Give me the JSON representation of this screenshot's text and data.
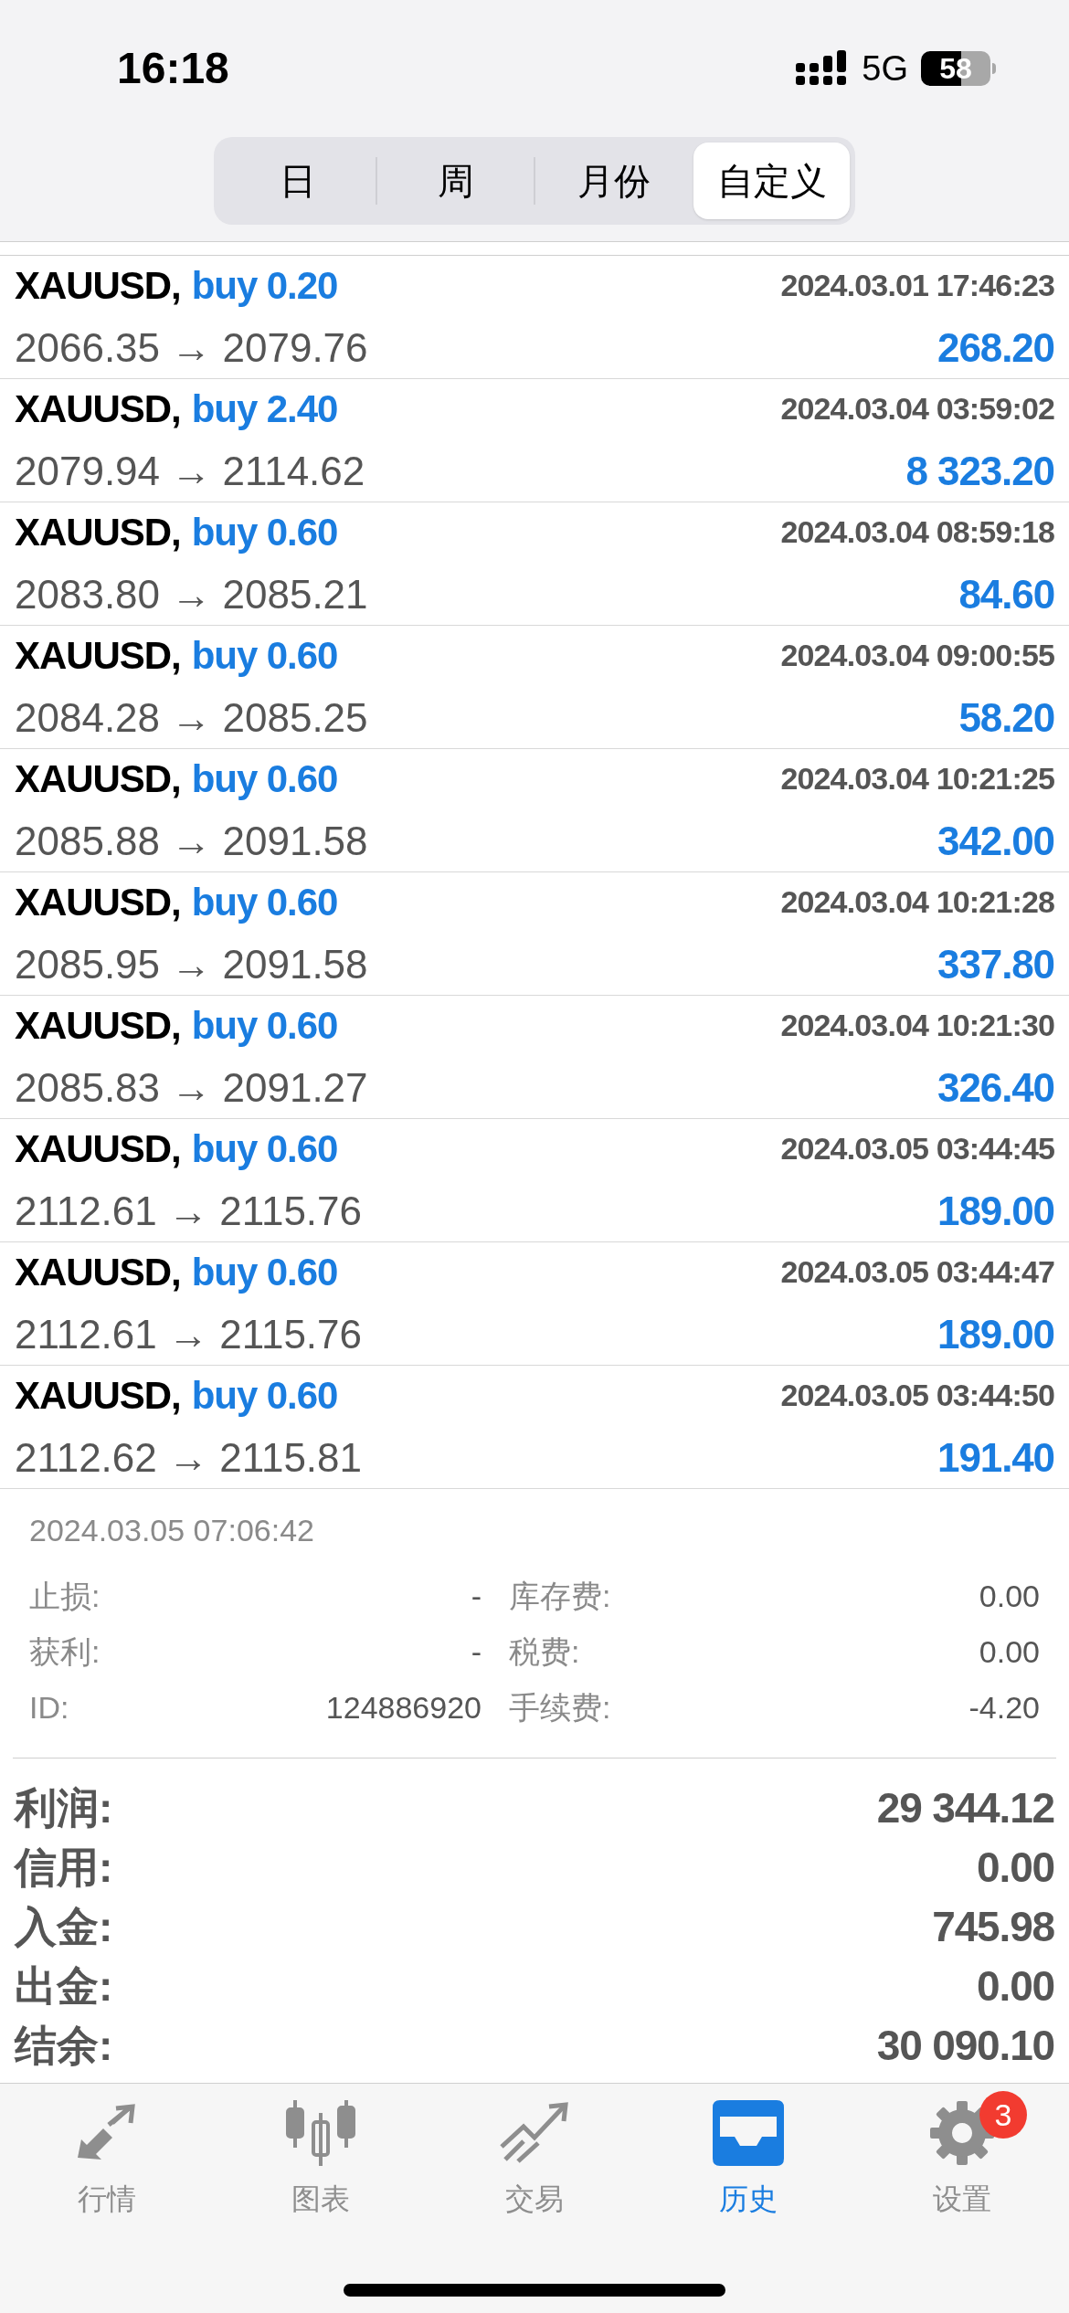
{
  "status_bar": {
    "time": "16:18",
    "network": "5G",
    "battery": "58"
  },
  "period_tabs": [
    {
      "label": "日",
      "selected": false
    },
    {
      "label": "周",
      "selected": false
    },
    {
      "label": "月份",
      "selected": false
    },
    {
      "label": "自定义",
      "selected": true
    }
  ],
  "deals": [
    {
      "symbol": "XAUUSD,",
      "side": "buy 0.20",
      "time": "2024.03.01 17:46:23",
      "prices": "2066.35 → 2079.76",
      "profit": "268.20"
    },
    {
      "symbol": "XAUUSD,",
      "side": "buy 2.40",
      "time": "2024.03.04 03:59:02",
      "prices": "2079.94 → 2114.62",
      "profit": "8 323.20"
    },
    {
      "symbol": "XAUUSD,",
      "side": "buy 0.60",
      "time": "2024.03.04 08:59:18",
      "prices": "2083.80 → 2085.21",
      "profit": "84.60"
    },
    {
      "symbol": "XAUUSD,",
      "side": "buy 0.60",
      "time": "2024.03.04 09:00:55",
      "prices": "2084.28 → 2085.25",
      "profit": "58.20"
    },
    {
      "symbol": "XAUUSD,",
      "side": "buy 0.60",
      "time": "2024.03.04 10:21:25",
      "prices": "2085.88 → 2091.58",
      "profit": "342.00"
    },
    {
      "symbol": "XAUUSD,",
      "side": "buy 0.60",
      "time": "2024.03.04 10:21:28",
      "prices": "2085.95 → 2091.58",
      "profit": "337.80"
    },
    {
      "symbol": "XAUUSD,",
      "side": "buy 0.60",
      "time": "2024.03.04 10:21:30",
      "prices": "2085.83 → 2091.27",
      "profit": "326.40"
    },
    {
      "symbol": "XAUUSD,",
      "side": "buy 0.60",
      "time": "2024.03.05 03:44:45",
      "prices": "2112.61 → 2115.76",
      "profit": "189.00"
    },
    {
      "symbol": "XAUUSD,",
      "side": "buy 0.60",
      "time": "2024.03.05 03:44:47",
      "prices": "2112.61 → 2115.76",
      "profit": "189.00"
    },
    {
      "symbol": "XAUUSD,",
      "side": "buy 0.60",
      "time": "2024.03.05 03:44:50",
      "prices": "2112.62 → 2115.81",
      "profit": "191.40"
    }
  ],
  "detail": {
    "time": "2024.03.05 07:06:42",
    "fields": [
      {
        "label": "止损:",
        "value": "-",
        "label2": "库存费:",
        "value2": "0.00"
      },
      {
        "label": "获利:",
        "value": "-",
        "label2": "税费:",
        "value2": "0.00"
      },
      {
        "label": "ID:",
        "value": "124886920",
        "label2": "手续费:",
        "value2": "-4.20"
      }
    ]
  },
  "summary": [
    {
      "label": "利润:",
      "value": "29 344.12"
    },
    {
      "label": "信用:",
      "value": "0.00"
    },
    {
      "label": "入金:",
      "value": "745.98"
    },
    {
      "label": "出金:",
      "value": "0.00"
    },
    {
      "label": "结余:",
      "value": "30 090.10"
    }
  ],
  "tab_bar": [
    {
      "kind": "quotes",
      "label": "行情",
      "selected": false
    },
    {
      "kind": "chart",
      "label": "图表",
      "selected": false
    },
    {
      "kind": "trade",
      "label": "交易",
      "selected": false
    },
    {
      "kind": "history",
      "label": "历史",
      "selected": true
    },
    {
      "kind": "settings",
      "label": "设置",
      "selected": false,
      "badge": "3"
    }
  ]
}
